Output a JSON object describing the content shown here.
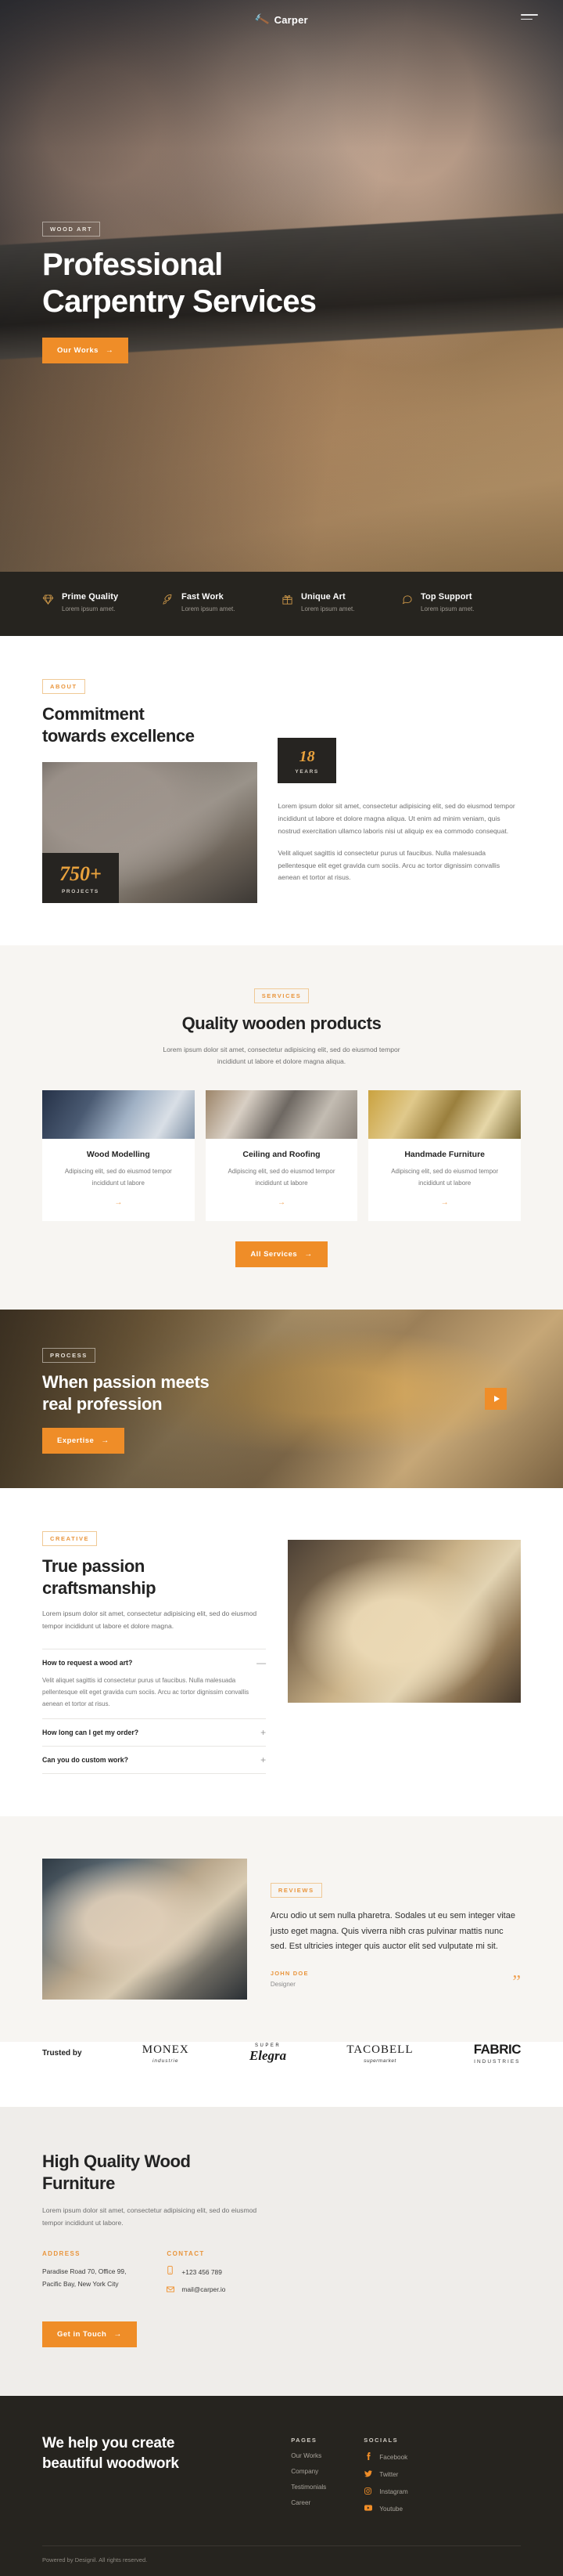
{
  "brand": {
    "name": "Carper",
    "icon": "hammer-icon"
  },
  "hero": {
    "badge": "WOOD ART",
    "title_line1": "Professional",
    "title_line2": "Carpentry Services",
    "cta": "Our Works",
    "cta_arrow": "→"
  },
  "features": [
    {
      "icon": "diamond-icon",
      "title": "Prime Quality",
      "subtitle": "Lorem ipsum amet."
    },
    {
      "icon": "rocket-icon",
      "title": "Fast Work",
      "subtitle": "Lorem ipsum amet."
    },
    {
      "icon": "gift-icon",
      "title": "Unique Art",
      "subtitle": "Lorem ipsum amet."
    },
    {
      "icon": "chat-bubble-icon",
      "title": "Top Support",
      "subtitle": "Lorem ipsum amet."
    }
  ],
  "about": {
    "badge": "ABOUT",
    "title_line1": "Commitment",
    "title_line2": "towards excellence",
    "stat_projects": {
      "number": "750+",
      "label": "PROJECTS"
    },
    "stat_years": {
      "number": "18",
      "label": "YEARS"
    },
    "paragraph1": "Lorem ipsum dolor sit amet, consectetur adipisicing elit, sed do eiusmod tempor incididunt ut labore et dolore magna aliqua. Ut enim ad minim veniam, quis nostrud exercitation ullamco laboris nisi ut aliquip ex ea commodo consequat.",
    "paragraph2": "Velit aliquet sagittis id consectetur purus ut faucibus. Nulla malesuada pellentesque elit eget gravida cum sociis. Arcu ac tortor dignissim convallis aenean et tortor at risus."
  },
  "services": {
    "badge": "SERVICES",
    "title": "Quality wooden products",
    "subtitle": "Lorem ipsum dolor sit amet, consectetur adipisicing elit, sed do eiusmod tempor incididunt ut labore et dolore magna aliqua.",
    "cards": [
      {
        "title": "Wood Modelling",
        "text": "Adipiscing elit, sed do eiusmod tempor incididunt ut labore",
        "arrow": "→"
      },
      {
        "title": "Ceiling and Roofing",
        "text": "Adipiscing elit, sed do eiusmod tempor incididunt ut labore",
        "arrow": "→"
      },
      {
        "title": "Handmade Furniture",
        "text": "Adipiscing elit, sed do eiusmod tempor incididunt ut labore",
        "arrow": "→"
      }
    ],
    "cta": "All Services",
    "cta_arrow": "→"
  },
  "process": {
    "badge": "PROCESS",
    "title_line1": "When passion meets",
    "title_line2": "real profession",
    "cta": "Expertise",
    "cta_arrow": "→",
    "play_label": "play-video"
  },
  "faq": {
    "badge": "CREATIVE",
    "title_line1": "True passion",
    "title_line2": "craftsmanship",
    "intro": "Lorem ipsum dolor sit amet, consectetur adipisicing elit, sed do eiusmod tempor incididunt ut labore et dolore magna.",
    "items": [
      {
        "question": "How to request a wood art?",
        "icon": "—",
        "answer": "Velit aliquet sagittis id consectetur purus ut faucibus. Nulla malesuada pellentesque elit eget gravida cum sociis. Arcu ac tortor dignissim convallis aenean et tortor at risus.",
        "open": true
      },
      {
        "question": "How long can I get my order?",
        "icon": "+",
        "answer": "",
        "open": false
      },
      {
        "question": "Can you do custom work?",
        "icon": "+",
        "answer": "",
        "open": false
      }
    ]
  },
  "reviews": {
    "badge": "REVIEWS",
    "quote": "Arcu odio ut sem nulla pharetra. Sodales ut eu sem integer vitae justo eget magna. Quis viverra nibh cras pulvinar mattis nunc sed. Est ultricies integer quis auctor elit sed vulputate mi sit.",
    "author": "JOHN DOE",
    "role": "Designer",
    "quote_mark": "”"
  },
  "trusted": {
    "label": "Trusted by",
    "logos": [
      {
        "main": "MONEX",
        "sub": "industrie",
        "style": "serif"
      },
      {
        "main": "Elegra",
        "sub": "",
        "top": "SUPER",
        "style": "script"
      },
      {
        "main": "TACOBELL",
        "sub": "supermarket",
        "style": "serif"
      },
      {
        "main": "FABRIC",
        "sub": "INDUSTRIES",
        "style": "bold"
      }
    ]
  },
  "contact": {
    "title_line1": "High Quality Wood",
    "title_line2": "Furniture",
    "text": "Lorem ipsum dolor sit amet, consectetur adipisicing elit, sed do eiusmod tempor incididunt ut labore.",
    "address_heading": "ADDRESS",
    "address_line1": "Paradise Road 70, Office 99,",
    "address_line2": "Pacific Bay,  New York City",
    "contact_heading": "CONTACT",
    "phone": "+123 456 789",
    "phone_icon": "phone-icon",
    "email": "mail@carper.io",
    "email_icon": "envelope-icon",
    "cta": "Get in Touch",
    "cta_arrow": "→"
  },
  "footer": {
    "headline_line1": "We help you create",
    "headline_line2": "beautiful woodwork",
    "pages_heading": "PAGES",
    "pages": [
      "Our Works",
      "Company",
      "Testimonials",
      "Career"
    ],
    "socials_heading": "SOCIALS",
    "socials": [
      {
        "icon": "facebook-icon",
        "glyph": "f",
        "label": "Facebook"
      },
      {
        "icon": "twitter-icon",
        "glyph": "ᵛ",
        "label": "Twitter"
      },
      {
        "icon": "instagram-icon",
        "glyph": "▣",
        "label": "Instagram"
      },
      {
        "icon": "youtube-icon",
        "glyph": "▶",
        "label": "Youtube"
      }
    ],
    "copyright": "Powered by Designil. All rights reserved."
  },
  "colors": {
    "accent": "#ef8d28",
    "dark": "#26241f",
    "amber": "#e9953c"
  }
}
